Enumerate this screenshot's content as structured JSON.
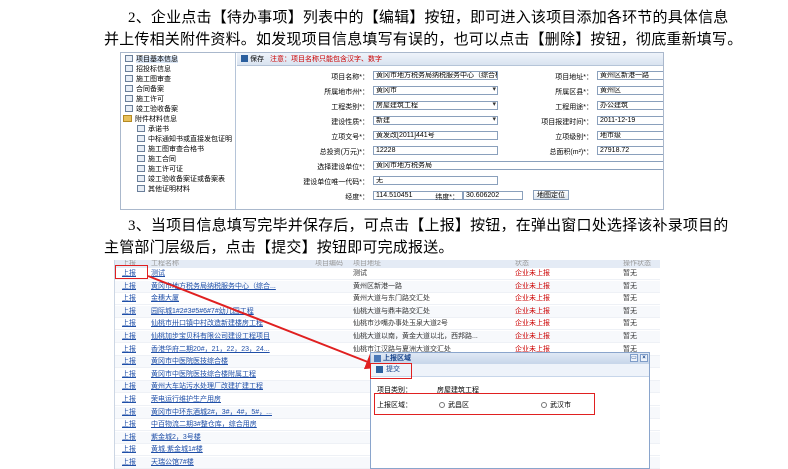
{
  "paragraphs": {
    "p2_line1": "2、企业点击【待办事项】列表中的【编辑】按钮，即可进入该项目添加各环节的具体信息",
    "p2_line2": "并上传相关附件资料。如发现项目信息填写有误的，也可以点击【删除】按钮，彻底重新填写。",
    "p3_line1": "3、当项目信息填写完毕并保存后，可点击【上报】按钮，在弹出窗口处选择该补录项目的",
    "p3_line2": "主管部门层级后，点击【提交】按钮即可完成报送。"
  },
  "tree": {
    "items": [
      "项目基本信息",
      "招投标信息",
      "施工图审查",
      "合同备案",
      "施工许可",
      "竣工验收备案",
      "附件材料信息",
      "承诺书",
      "中标通知书或直接发包证明",
      "施工图审查合格书",
      "施工合同",
      "施工许可证",
      "竣工验收备案证或备案表",
      "其他证明材料"
    ]
  },
  "form": {
    "toolbar_save": "保存",
    "toolbar_note": "注意：项目名称只能包含汉字、数字",
    "project_name_label": "项目名称*：",
    "project_name_value": "黄冈市地方税务局纳税服务中心（综合楼）",
    "project_addr_label": "项目地址*：",
    "project_addr_value": "黄州区新港一路",
    "city_label": "所属地市州*：",
    "city_value": "黄冈市",
    "district_label": "所属区县*：",
    "district_value": "黄州区",
    "type_label": "工程类别*：",
    "type_value": "房屋建筑工程",
    "usage_label": "工程用途*：",
    "usage_value": "办公建筑",
    "nature_label": "建设性质*：",
    "nature_value": "新建",
    "report_time_label": "项目报建时间*：",
    "report_time_value": "2011-12-19",
    "approval_no_label": "立项文号*：",
    "approval_no_value": "黄发改[2011]441号",
    "approval_level_label": "立项级别*：",
    "approval_level_value": "地市级",
    "invest_label": "总投资(万元)*：",
    "invest_value": "12228",
    "area_label": "总面积(m²)*：",
    "area_value": "27918.72",
    "unit_label": "选择建设单位*：",
    "unit_value": "黄冈市地方税务局",
    "unit_code_label": "建设单位唯一代码*：",
    "unit_code_value": "无",
    "lng_label": "经度*：",
    "lng_value": "114.510451",
    "lat_label": "纬度*：",
    "lat_value": "30.606202",
    "locate_button": "地图定位"
  },
  "list": {
    "headers": [
      "上报",
      "工程名称",
      "项目编码",
      "项目地址",
      "状态",
      "操作状态"
    ],
    "rows": [
      {
        "act": "上报",
        "name": "测试",
        "addr": "测试",
        "status": "企业未上报",
        "flow": "暂无"
      },
      {
        "act": "上报",
        "name": "黄冈市地方税务局纳税服务中心（综合...",
        "addr": "黄州区新港一路",
        "status": "企业未上报",
        "flow": "暂无"
      },
      {
        "act": "上报",
        "name": "金穗大厦",
        "addr": "黄州大道与东门路交汇处",
        "status": "企业未上报",
        "flow": "暂无"
      },
      {
        "act": "上报",
        "name": "园际城1#2#3#5#6#7#幼儿园工程",
        "addr": "仙桃大道与鼎丰路交汇处",
        "status": "企业未上报",
        "flow": "暂无"
      },
      {
        "act": "上报",
        "name": "仙桃市卅口镇中村改造新建楼房工程",
        "addr": "仙桃市沙嘴办事处玉泉大道2号",
        "status": "企业未上报",
        "flow": "暂无"
      },
      {
        "act": "上报",
        "name": "仙桃加步宝贝科有限公司建设工程项目",
        "addr": "仙桃大道以南，黄金大道以北，西邦路...",
        "status": "企业未上报",
        "flow": "暂无"
      },
      {
        "act": "上报",
        "name": "香港华府二期20#，21，22，23，24...",
        "addr": "仙桃市江汉路与夏洲大道交汇处",
        "status": "企业未上报",
        "flow": "暂无"
      },
      {
        "act": "上报",
        "name": "黄冈市中医院医技综合楼",
        "addr": "",
        "status": "",
        "flow": ""
      },
      {
        "act": "上报",
        "name": "黄冈市中医院医技综合楼附属工程",
        "addr": "",
        "status": "",
        "flow": ""
      },
      {
        "act": "上报",
        "name": "黄州大车站污水处理厂改建扩建工程",
        "addr": "",
        "status": "",
        "flow": ""
      },
      {
        "act": "上报",
        "name": "荣电运行维护生产用房",
        "addr": "",
        "status": "",
        "flow": ""
      },
      {
        "act": "上报",
        "name": "黄冈市中环东酒城2#，3#，4#，5#，...",
        "addr": "",
        "status": "",
        "flow": ""
      },
      {
        "act": "上报",
        "name": "中百物流二期3#整仓库，综合用房",
        "addr": "",
        "status": "",
        "flow": ""
      },
      {
        "act": "上报",
        "name": "紫金城2，3号楼",
        "addr": "",
        "status": "",
        "flow": ""
      },
      {
        "act": "上报",
        "name": "黄城.紫金城1#楼",
        "addr": "",
        "status": "",
        "flow": ""
      },
      {
        "act": "上报",
        "name": "天瑞公馆7#楼",
        "addr": "",
        "status": "",
        "flow": ""
      }
    ]
  },
  "popup": {
    "title": "上报区域",
    "submit": "提交",
    "type_label": "项目类别：",
    "type_value": "房屋建筑工程",
    "region_label": "上报区域：",
    "option1": "武昌区",
    "option2": "武汉市"
  }
}
